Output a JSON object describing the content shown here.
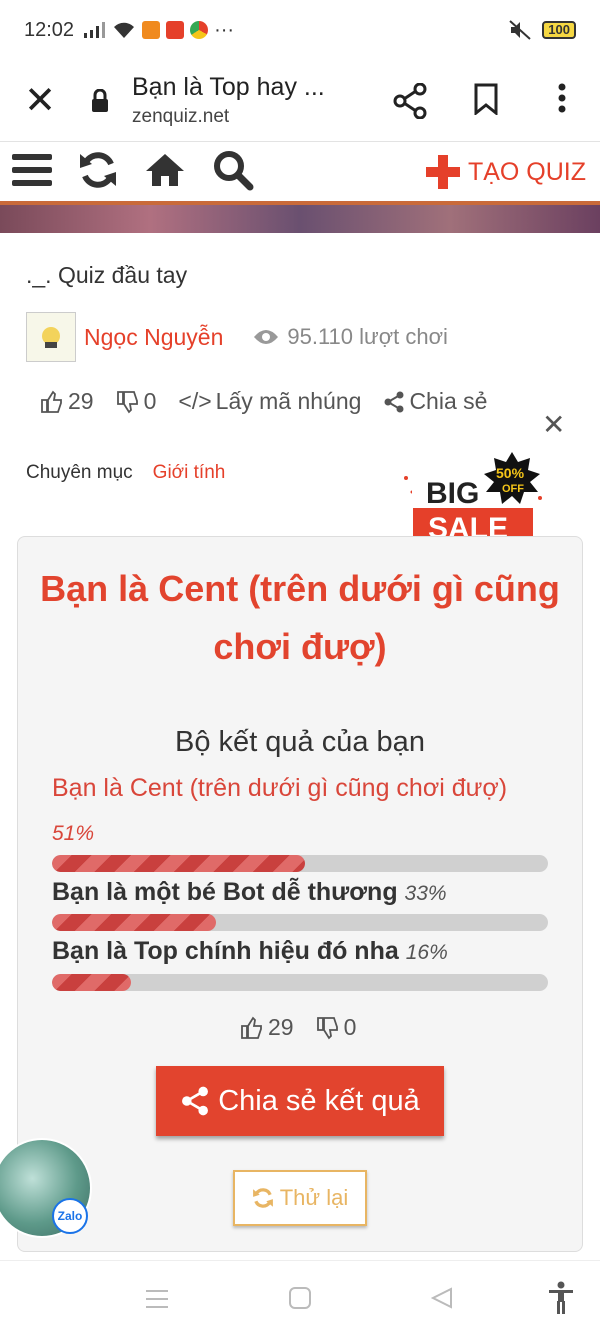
{
  "status": {
    "time": "12:02",
    "battery": "100"
  },
  "browser": {
    "page_title": "Bạn là Top hay ...",
    "domain": "zenquiz.net"
  },
  "nav": {
    "create_label": "TẠO QUIZ"
  },
  "quiz": {
    "title": "._. Quiz đầu tay",
    "author": "Ngọc Nguyễn",
    "plays": "95.110 lượt chơi",
    "likes": "29",
    "dislikes": "0",
    "embed_label": "Lấy mã nhúng",
    "share_label": "Chia sẻ",
    "category_label": "Chuyên mục",
    "category_value": "Giới tính"
  },
  "ad": {
    "big": "BIG",
    "sale": "SALE",
    "pct": "50%",
    "off": "OFF"
  },
  "result": {
    "title": "Bạn là Cent (trên dưới gì cũng chơi đượ)",
    "heading": "Bộ kết quả của bạn",
    "items": [
      {
        "label": "Bạn là Cent (trên dưới gì cũng chơi đượ)",
        "percent": "51%",
        "value": 51
      },
      {
        "label": "Bạn là một bé Bot dễ thương",
        "percent": "33%",
        "value": 33
      },
      {
        "label": "Bạn là Top chính hiệu đó nha",
        "percent": "16%",
        "value": 16
      }
    ],
    "likes": "29",
    "dislikes": "0",
    "share_button": "Chia sẻ kết quả",
    "retry_button": "Thử lại"
  },
  "zalo": {
    "label": "Zalo"
  },
  "colors": {
    "accent": "#e2442e",
    "retry": "#e8b563"
  }
}
